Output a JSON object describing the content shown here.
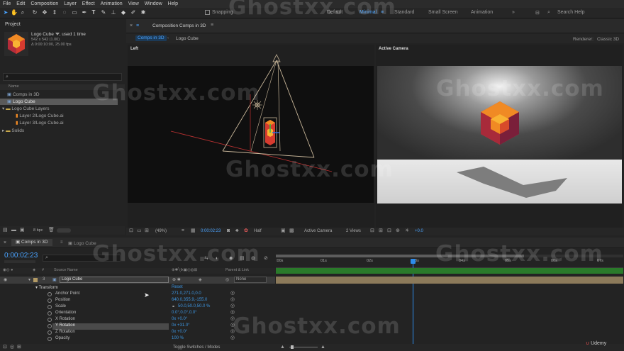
{
  "menu": [
    "File",
    "Edit",
    "Composition",
    "Layer",
    "Effect",
    "Animation",
    "View",
    "Window",
    "Help"
  ],
  "toolbar": {
    "snapping": "Snapping",
    "workspaces": [
      "Default",
      "Minimal",
      "Standard",
      "Small Screen",
      "Animation"
    ],
    "active_workspace": "Minimal",
    "search": "Search Help"
  },
  "project": {
    "title": "Project",
    "item_name": "Logo Cube",
    "item_used": ", used 1 time",
    "item_size": "542 x 542 (1.00)",
    "item_duration": "Δ 0:00:10:00, 25.00 fps",
    "search_placeholder": "",
    "col_name": "Name",
    "items": [
      "Comps in 3D",
      "Logo Cube",
      "Logo Cube Layers",
      "Layer 2/Logo Cube.ai",
      "Layer 3/Logo Cube.ai",
      "Solids"
    ],
    "bpc": "8 bpc"
  },
  "composition": {
    "tab_label": "Composition Comps in 3D",
    "crumbs": [
      "Comps in 3D",
      "Logo Cube"
    ],
    "renderer_label": "Renderer:",
    "renderer_value": "Classic 3D",
    "left_view_label": "Left",
    "right_view_label": "Active Camera",
    "zoom": "(49%)",
    "timecode": "0:00:02:23",
    "resolution": "Half",
    "camera": "Active Camera",
    "views": "2 Views",
    "offset": "+0.0"
  },
  "timeline": {
    "tabs": [
      "Comps in 3D",
      "Logo Cube"
    ],
    "timecode": "0:00:02:23",
    "ruler": [
      ":00s",
      "01s",
      "02s",
      "03s",
      "04s",
      "05s",
      "06s",
      "07s"
    ],
    "col_source": "Source Name",
    "col_parent": "Parent & Link",
    "layer_num": "3",
    "layer_name": "Logo Cube",
    "layer_parent": "None",
    "transform": "Transform",
    "reset": "Reset",
    "props": [
      {
        "name": "Anchor Point",
        "value": "271.0,271.0,0.0"
      },
      {
        "name": "Position",
        "value": "640.0,355.9,-155.0"
      },
      {
        "name": "Scale",
        "value": "50.0,50.0,50.0 %"
      },
      {
        "name": "Orientation",
        "value": "0.0°,0.0°,0.0°"
      },
      {
        "name": "X Rotation",
        "value": "0x +0.0°"
      },
      {
        "name": "Y Rotation",
        "value": "0x +31.0°"
      },
      {
        "name": "Z Rotation",
        "value": "0x +0.0°"
      },
      {
        "name": "Opacity",
        "value": "100 %"
      }
    ],
    "toggle_label": "Toggle Switches / Modes"
  },
  "watermark": "Ghostxx.com",
  "udemy": "Udemy",
  "colors": {
    "accent": "#2d8ceb",
    "cube_orange": "#f08a24",
    "cube_red": "#d63b2f",
    "cube_dark": "#7a1f3a"
  }
}
